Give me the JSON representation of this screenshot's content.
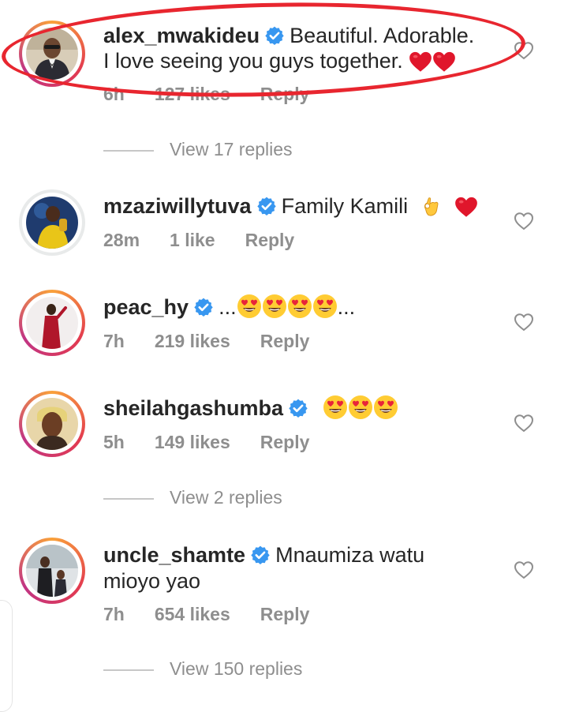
{
  "comments": [
    {
      "username": "alex_mwakideu",
      "text": "Beautiful. Adorable.",
      "text2": "I love seeing you guys together.",
      "time": "6h",
      "likes": "127 likes",
      "reply": "Reply",
      "view_replies": "View 17 replies"
    },
    {
      "username": "mzaziwillytuva",
      "text": "Family Kamili",
      "time": "28m",
      "likes": "1 like",
      "reply": "Reply"
    },
    {
      "username": "peac_hy",
      "text": "...",
      "text_end": "...",
      "time": "7h",
      "likes": "219 likes",
      "reply": "Reply"
    },
    {
      "username": "sheilahgashumba",
      "time": "5h",
      "likes": "149 likes",
      "reply": "Reply",
      "view_replies": "View 2 replies"
    },
    {
      "username": "uncle_shamte",
      "text": "Mnaumiza watu",
      "text2": "mioyo yao",
      "time": "7h",
      "likes": "654 likes",
      "reply": "Reply",
      "view_replies": "View 150 replies"
    }
  ],
  "colors": {
    "verified": "#3897f0",
    "meta": "#8e8e8e",
    "highlight_ring": "#e8262f",
    "heart_red": "#e0162b"
  },
  "icons": [
    "verified-badge-icon",
    "heart-outline-icon",
    "red-heart-emoji",
    "ok-hand-emoji",
    "heart-eyes-emoji"
  ]
}
